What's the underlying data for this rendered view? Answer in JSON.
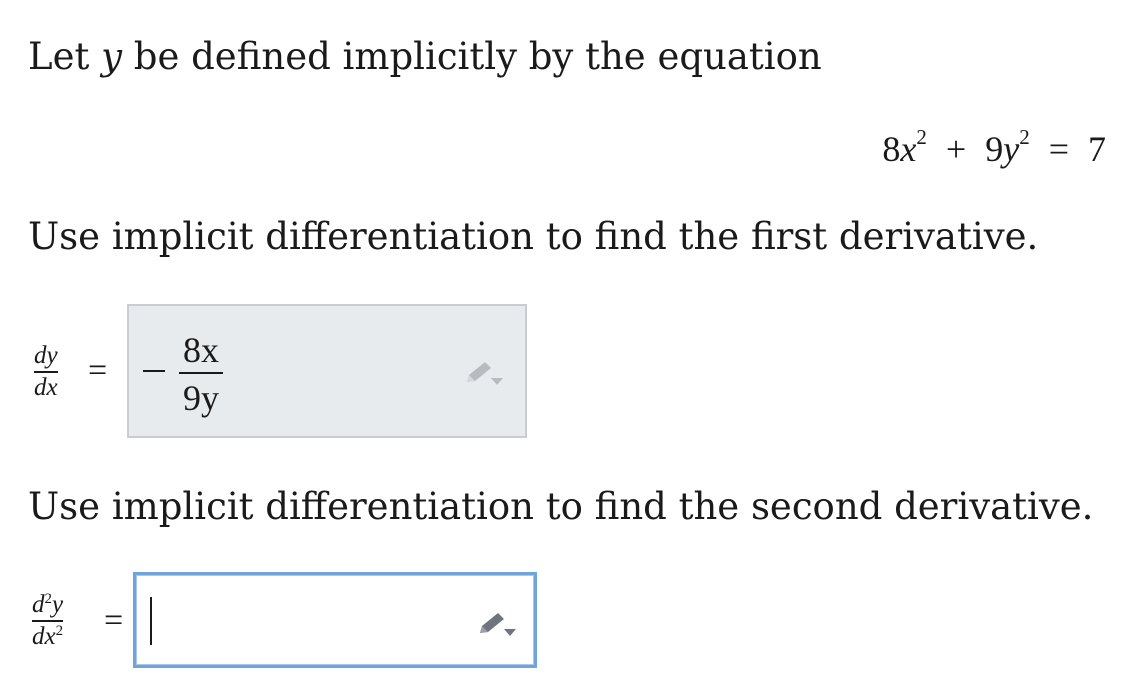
{
  "prompt1": {
    "before": "Let ",
    "var": "y",
    "after": " be defined implicitly by the equation"
  },
  "equation": {
    "a": "8",
    "x": "x",
    "b": "9",
    "y": "y",
    "exp": "2",
    "plus": "+",
    "eq": "=",
    "rhs": "7"
  },
  "prompt2": "Use implicit differentiation to find the first derivative.",
  "first_derivative": {
    "label_num": "dy",
    "label_den": "dx",
    "equals": "=",
    "answer": {
      "sign": "−",
      "numerator": "8x",
      "denominator": "9y"
    }
  },
  "prompt3": "Use implicit differentiation to find the second derivative.",
  "second_derivative": {
    "label_num_d": "d",
    "label_num_exp": "2",
    "label_num_y": "y",
    "label_den": "dx",
    "label_den_exp": "2",
    "equals": "=",
    "input_value": ""
  },
  "icons": {
    "edit": "pencil-icon",
    "dropdown": "caret-down-icon"
  },
  "colors": {
    "filled_box": "#e8ebee",
    "focus_border": "#6fa3d9",
    "icon": "#8a8f96"
  }
}
